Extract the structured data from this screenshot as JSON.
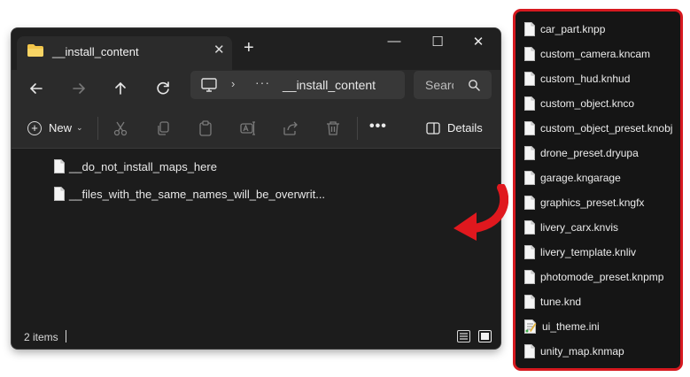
{
  "window": {
    "tab_title": "__install_content",
    "close_tab": "✕",
    "new_tab": "+",
    "controls": {
      "minimize": "—",
      "maximize": "☐",
      "close": "✕"
    }
  },
  "address": {
    "path": "__install_content",
    "separator": "›",
    "overflow": "···"
  },
  "search": {
    "placeholder": "Search"
  },
  "toolbar": {
    "new_label": "New",
    "caret": "⌄",
    "more": "•••",
    "details_label": "Details"
  },
  "files": [
    {
      "name": "__do_not_install_maps_here"
    },
    {
      "name": "__files_with_the_same_names_will_be_overwrit..."
    }
  ],
  "status": {
    "items": "2 items"
  },
  "panel_files": [
    {
      "name": "car_part.knpp"
    },
    {
      "name": "custom_camera.kncam"
    },
    {
      "name": "custom_hud.knhud"
    },
    {
      "name": "custom_object.knco"
    },
    {
      "name": "custom_object_preset.knobj"
    },
    {
      "name": "drone_preset.dryupa"
    },
    {
      "name": "garage.kngarage"
    },
    {
      "name": "graphics_preset.kngfx"
    },
    {
      "name": "livery_carx.knvis"
    },
    {
      "name": "livery_template.knliv"
    },
    {
      "name": "photomode_preset.knpmp"
    },
    {
      "name": "tune.knd"
    },
    {
      "name": "ui_theme.ini"
    },
    {
      "name": "unity_map.knmap"
    }
  ],
  "colors": {
    "accent_red": "#d6191f",
    "window_bg": "#1c1c1c",
    "folder": "#f3c64a"
  }
}
